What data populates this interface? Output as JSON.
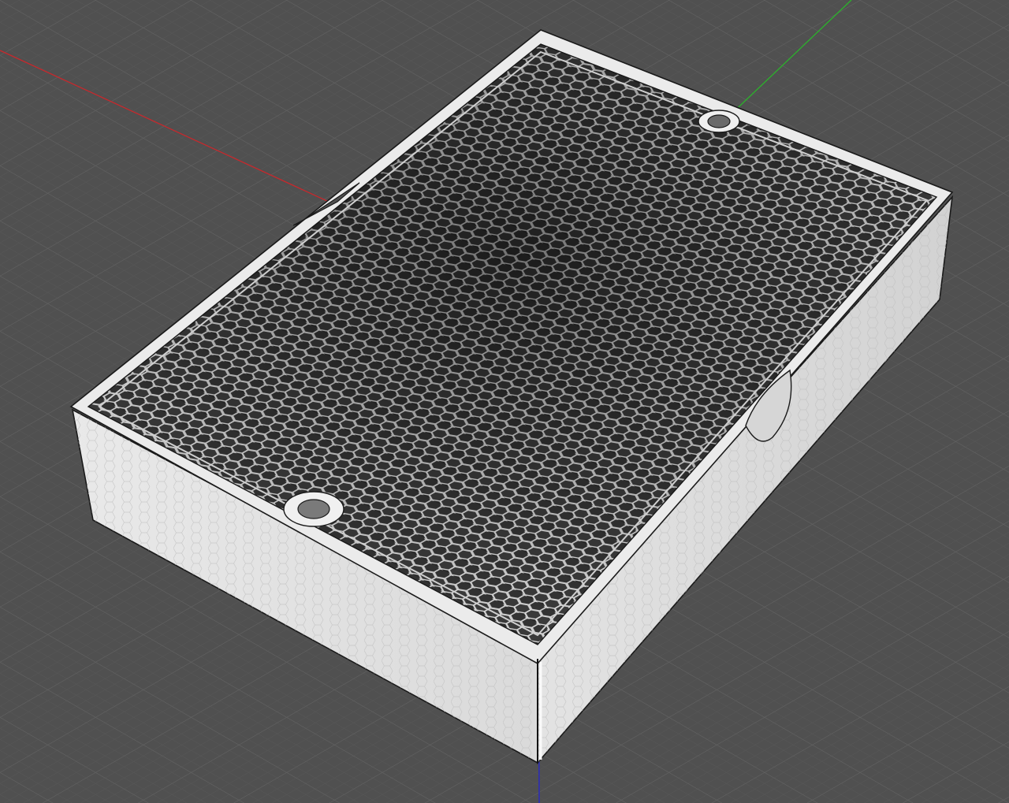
{
  "viewport": {
    "background": "#505050",
    "grid_minor_color": "#5a5a5a",
    "grid_major_color": "#636363"
  },
  "axes": {
    "x_color": "#c8282c",
    "y_color": "#2bb32b",
    "z_color": "#2424cc"
  },
  "model": {
    "body_color": "#e6e6e6",
    "edge_color": "#1a1a1a",
    "cavity_color": "#2b2b2b",
    "side_faces": [
      "front-left",
      "front-right"
    ],
    "mounting_holes": 2,
    "cutouts": 3
  }
}
